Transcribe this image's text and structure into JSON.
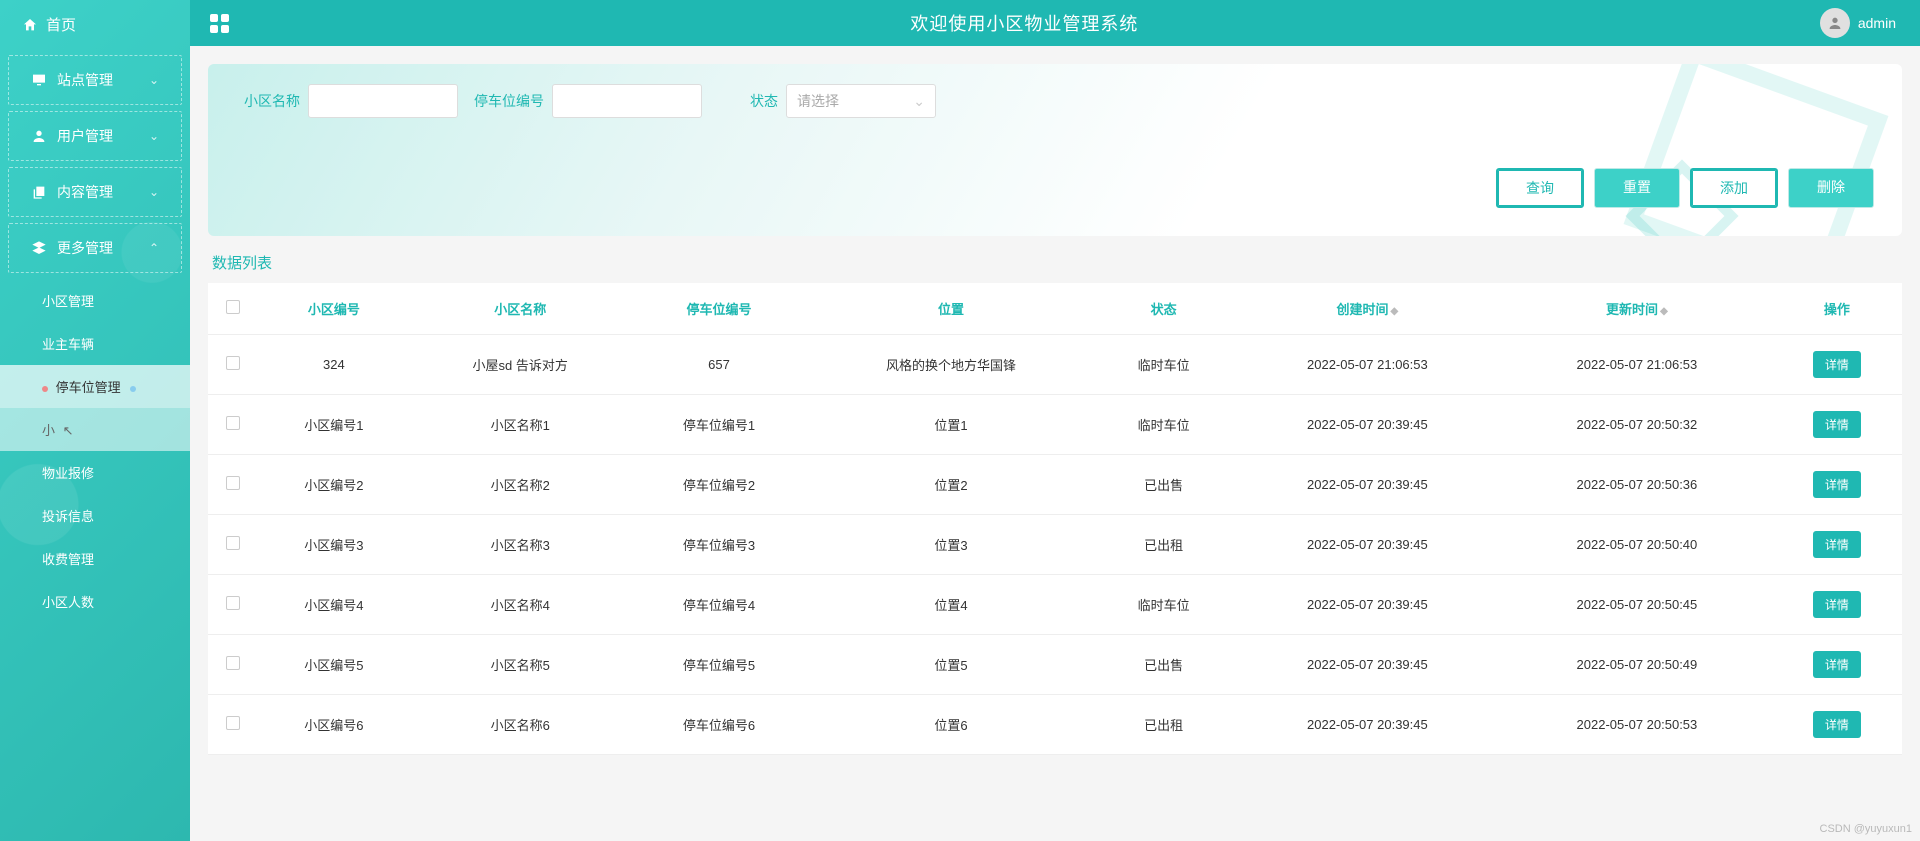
{
  "header": {
    "title": "欢迎使用小区物业管理系统",
    "username": "admin"
  },
  "sidebar": {
    "home": "首页",
    "items": [
      {
        "label": "站点管理",
        "expanded": false
      },
      {
        "label": "用户管理",
        "expanded": false
      },
      {
        "label": "内容管理",
        "expanded": false
      },
      {
        "label": "更多管理",
        "expanded": true
      }
    ],
    "subitems": [
      {
        "label": "小区管理"
      },
      {
        "label": "业主车辆"
      },
      {
        "label": "停车位管理",
        "active": true
      },
      {
        "label": "小",
        "hover": true
      },
      {
        "label": "物业报修"
      },
      {
        "label": "投诉信息"
      },
      {
        "label": "收费管理"
      },
      {
        "label": "小区人数"
      }
    ]
  },
  "search": {
    "label_xqmc": "小区名称",
    "label_cwbh": "停车位编号",
    "label_zt": "状态",
    "select_placeholder": "请选择",
    "btn_query": "查询",
    "btn_reset": "重置",
    "btn_add": "添加",
    "btn_delete": "删除"
  },
  "list": {
    "title": "数据列表",
    "columns": [
      "小区编号",
      "小区名称",
      "停车位编号",
      "位置",
      "状态",
      "创建时间",
      "更新时间",
      "操作"
    ],
    "detail_label": "详情",
    "rows": [
      {
        "c": [
          "324",
          "小屋sd 告诉对方",
          "657",
          "风格的换个地方华国锋",
          "临时车位",
          "2022-05-07 21:06:53",
          "2022-05-07 21:06:53"
        ]
      },
      {
        "c": [
          "小区编号1",
          "小区名称1",
          "停车位编号1",
          "位置1",
          "临时车位",
          "2022-05-07 20:39:45",
          "2022-05-07 20:50:32"
        ]
      },
      {
        "c": [
          "小区编号2",
          "小区名称2",
          "停车位编号2",
          "位置2",
          "已出售",
          "2022-05-07 20:39:45",
          "2022-05-07 20:50:36"
        ]
      },
      {
        "c": [
          "小区编号3",
          "小区名称3",
          "停车位编号3",
          "位置3",
          "已出租",
          "2022-05-07 20:39:45",
          "2022-05-07 20:50:40"
        ]
      },
      {
        "c": [
          "小区编号4",
          "小区名称4",
          "停车位编号4",
          "位置4",
          "临时车位",
          "2022-05-07 20:39:45",
          "2022-05-07 20:50:45"
        ]
      },
      {
        "c": [
          "小区编号5",
          "小区名称5",
          "停车位编号5",
          "位置5",
          "已出售",
          "2022-05-07 20:39:45",
          "2022-05-07 20:50:49"
        ]
      },
      {
        "c": [
          "小区编号6",
          "小区名称6",
          "停车位编号6",
          "位置6",
          "已出租",
          "2022-05-07 20:39:45",
          "2022-05-07 20:50:53"
        ]
      }
    ]
  },
  "watermark": "CSDN @yuyuxun1"
}
